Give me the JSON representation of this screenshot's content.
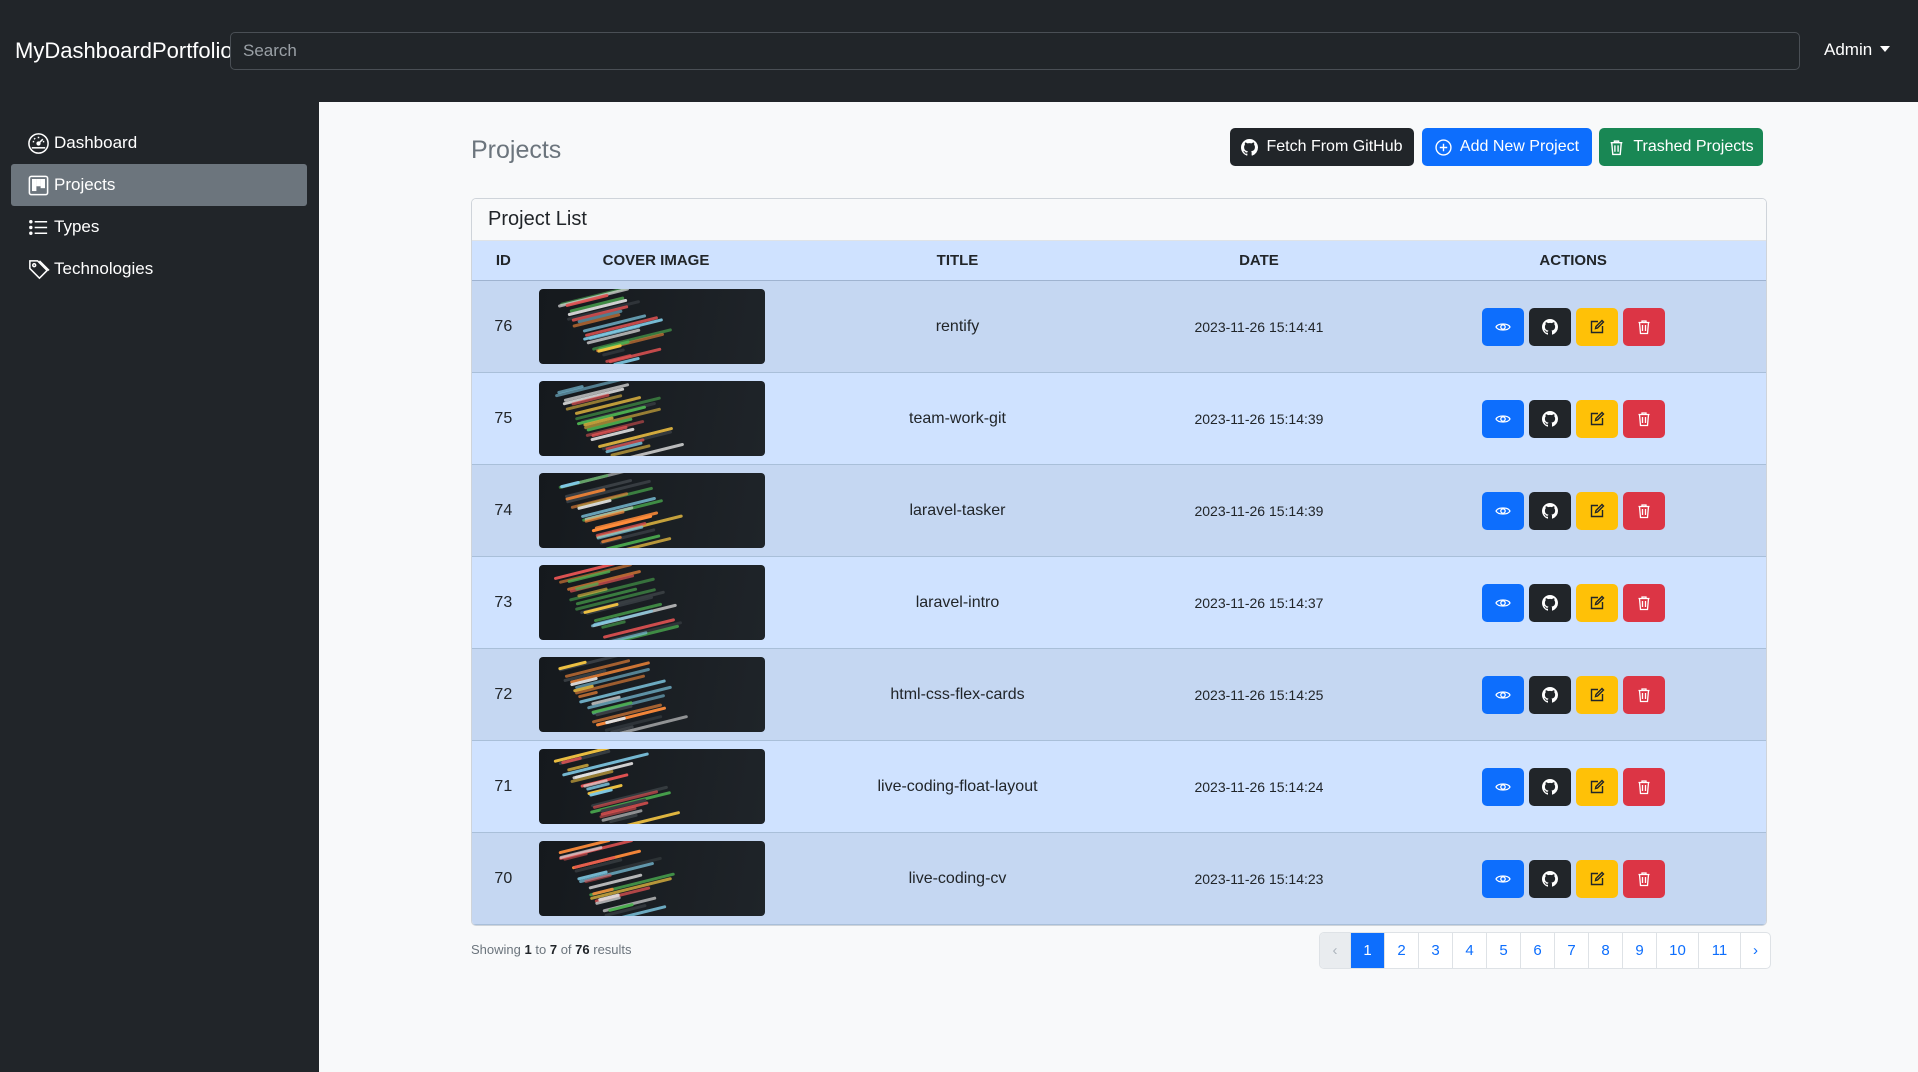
{
  "navbar": {
    "brand": "MyDashboardPortfolio",
    "search_placeholder": "Search",
    "user": "Admin"
  },
  "sidebar": {
    "items": [
      {
        "label": "Dashboard",
        "icon": "speedometer-icon",
        "active": false
      },
      {
        "label": "Projects",
        "icon": "kanban-icon",
        "active": true
      },
      {
        "label": "Types",
        "icon": "list-icon",
        "active": false
      },
      {
        "label": "Technologies",
        "icon": "tags-icon",
        "active": false
      }
    ]
  },
  "header": {
    "title": "Projects",
    "fetch_label": "Fetch From GitHub",
    "add_label": "Add New Project",
    "trashed_label": "Trashed Projects",
    "colors": {
      "fetch": "#212529",
      "add": "#0d6efd",
      "trashed": "#198754"
    }
  },
  "table": {
    "card_title": "Project List",
    "columns": [
      "ID",
      "COVER IMAGE",
      "TITLE",
      "DATE",
      "ACTIONS"
    ],
    "rows": [
      {
        "id": "76",
        "title": "rentify",
        "date": "2023-11-26 15:14:41"
      },
      {
        "id": "75",
        "title": "team-work-git",
        "date": "2023-11-26 15:14:39"
      },
      {
        "id": "74",
        "title": "laravel-tasker",
        "date": "2023-11-26 15:14:39"
      },
      {
        "id": "73",
        "title": "laravel-intro",
        "date": "2023-11-26 15:14:37"
      },
      {
        "id": "72",
        "title": "html-css-flex-cards",
        "date": "2023-11-26 15:14:25"
      },
      {
        "id": "71",
        "title": "live-coding-float-layout",
        "date": "2023-11-26 15:14:24"
      },
      {
        "id": "70",
        "title": "live-coding-cv",
        "date": "2023-11-26 15:14:23"
      }
    ],
    "action_icons": [
      "eye-icon",
      "github-icon",
      "edit-icon",
      "trash-icon"
    ],
    "action_colors": [
      "#0d6efd",
      "#212529",
      "#ffc107",
      "#dc3545"
    ]
  },
  "pagination": {
    "summary_prefix": "Showing",
    "from": "1",
    "to_word": "to",
    "to": "7",
    "of_word": "of",
    "total": "76",
    "suffix": "results",
    "prev": "‹",
    "next": "›",
    "pages": [
      "1",
      "2",
      "3",
      "4",
      "5",
      "6",
      "7",
      "8",
      "9",
      "10",
      "11"
    ],
    "current": "1"
  }
}
